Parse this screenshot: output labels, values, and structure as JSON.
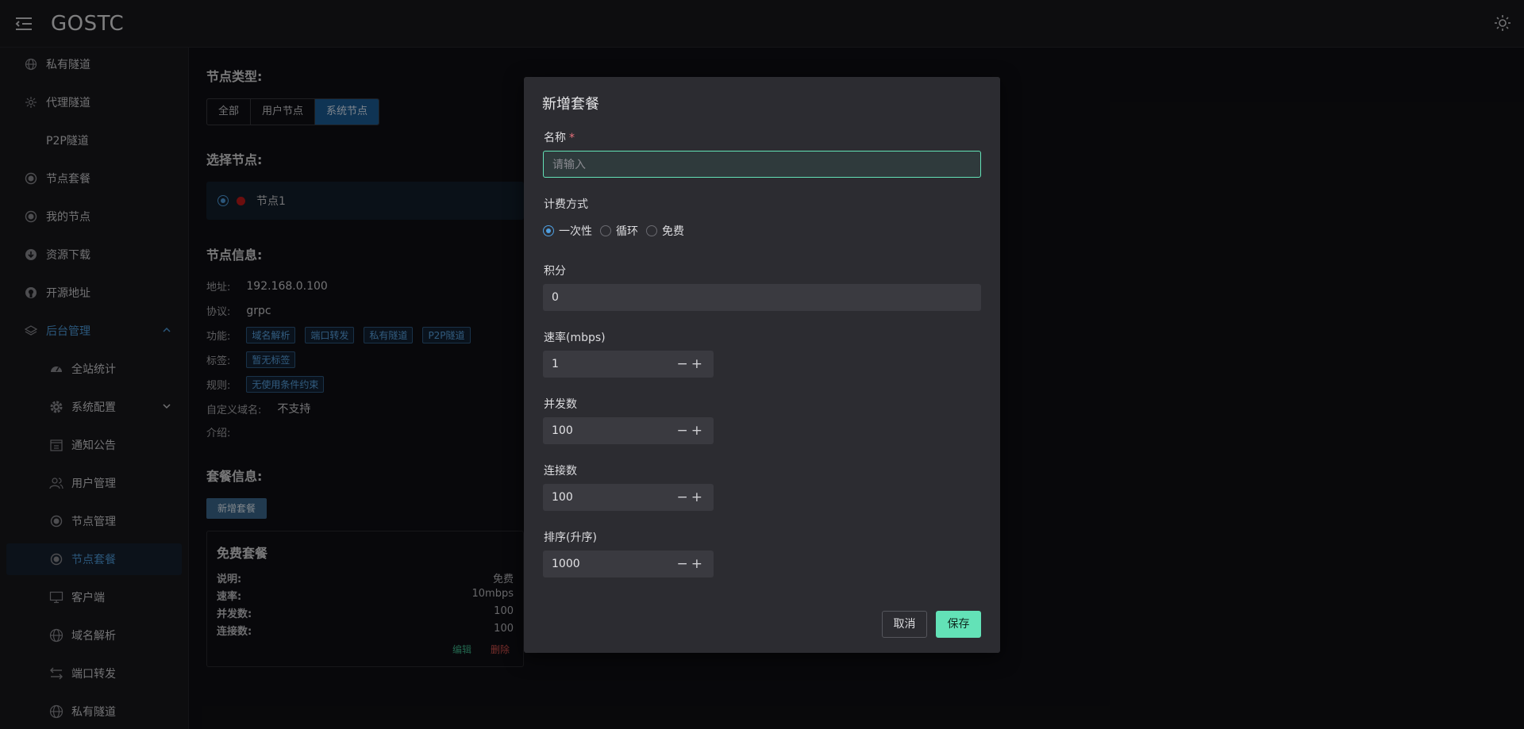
{
  "header": {
    "title": "GOSTC"
  },
  "sidebar": {
    "items": [
      {
        "label": "私有隧道",
        "icon": "globe-icon"
      },
      {
        "label": "代理隧道",
        "icon": "proxy-icon"
      },
      {
        "label": "P2P隧道",
        "icon": "p2p-icon"
      },
      {
        "label": "节点套餐",
        "icon": "node-icon"
      },
      {
        "label": "我的节点",
        "icon": "node-icon"
      },
      {
        "label": "资源下载",
        "icon": "download-icon"
      },
      {
        "label": "开源地址",
        "icon": "github-icon"
      },
      {
        "label": "后台管理",
        "icon": "layers-icon"
      },
      {
        "label": "全站统计",
        "icon": "dashboard-icon"
      },
      {
        "label": "系统配置",
        "icon": "gear-icon"
      },
      {
        "label": "通知公告",
        "icon": "notice-icon"
      },
      {
        "label": "用户管理",
        "icon": "users-icon"
      },
      {
        "label": "节点管理",
        "icon": "node-icon"
      },
      {
        "label": "节点套餐",
        "icon": "node-icon"
      },
      {
        "label": "客户端",
        "icon": "monitor-icon"
      },
      {
        "label": "域名解析",
        "icon": "globe-icon"
      },
      {
        "label": "端口转发",
        "icon": "swap-icon"
      },
      {
        "label": "私有隧道",
        "icon": "globe-icon"
      }
    ]
  },
  "main": {
    "node_type_title": "节点类型:",
    "node_type_tabs": [
      "全部",
      "用户节点",
      "系统节点"
    ],
    "select_node_title": "选择节点:",
    "node_name": "节点1",
    "node_info_title": "节点信息:",
    "info": {
      "address_label": "地址:",
      "address": "192.168.0.100",
      "protocol_label": "协议:",
      "protocol": "grpc",
      "features_label": "功能:",
      "features": [
        "域名解析",
        "端口转发",
        "私有隧道",
        "P2P隧道"
      ],
      "tags_label": "标签:",
      "tags": [
        "暂无标签"
      ],
      "rules_label": "规则:",
      "rules": [
        "无使用条件约束"
      ],
      "custom_domain_label": "自定义域名:",
      "custom_domain": "不支持",
      "intro_label": "介绍:"
    },
    "package_info_title": "套餐信息:",
    "add_package_label": "新增套餐",
    "package": {
      "name": "免费套餐",
      "rows": [
        {
          "k": "说明:",
          "v": "免费"
        },
        {
          "k": "速率:",
          "v": "10mbps"
        },
        {
          "k": "并发数:",
          "v": "100"
        },
        {
          "k": "连接数:",
          "v": "100"
        }
      ],
      "edit": "编辑",
      "delete": "删除"
    }
  },
  "modal": {
    "title": "新增套餐",
    "name_label": "名称",
    "required_mark": "*",
    "name_placeholder": "请输入",
    "billing_label": "计费方式",
    "billing_options": [
      "一次性",
      "循环",
      "免费"
    ],
    "points_label": "积分",
    "points_value": "0",
    "rate_label": "速率(mbps)",
    "rate_value": "1",
    "concurrency_label": "并发数",
    "concurrency_value": "100",
    "connections_label": "连接数",
    "connections_value": "100",
    "sort_label": "排序(升序)",
    "sort_value": "1000",
    "cancel_label": "取消",
    "save_label": "保存"
  },
  "colors": {
    "accent_blue": "#4f9fe0",
    "accent_green": "#63e2b7",
    "danger_red": "#c41a1a"
  }
}
